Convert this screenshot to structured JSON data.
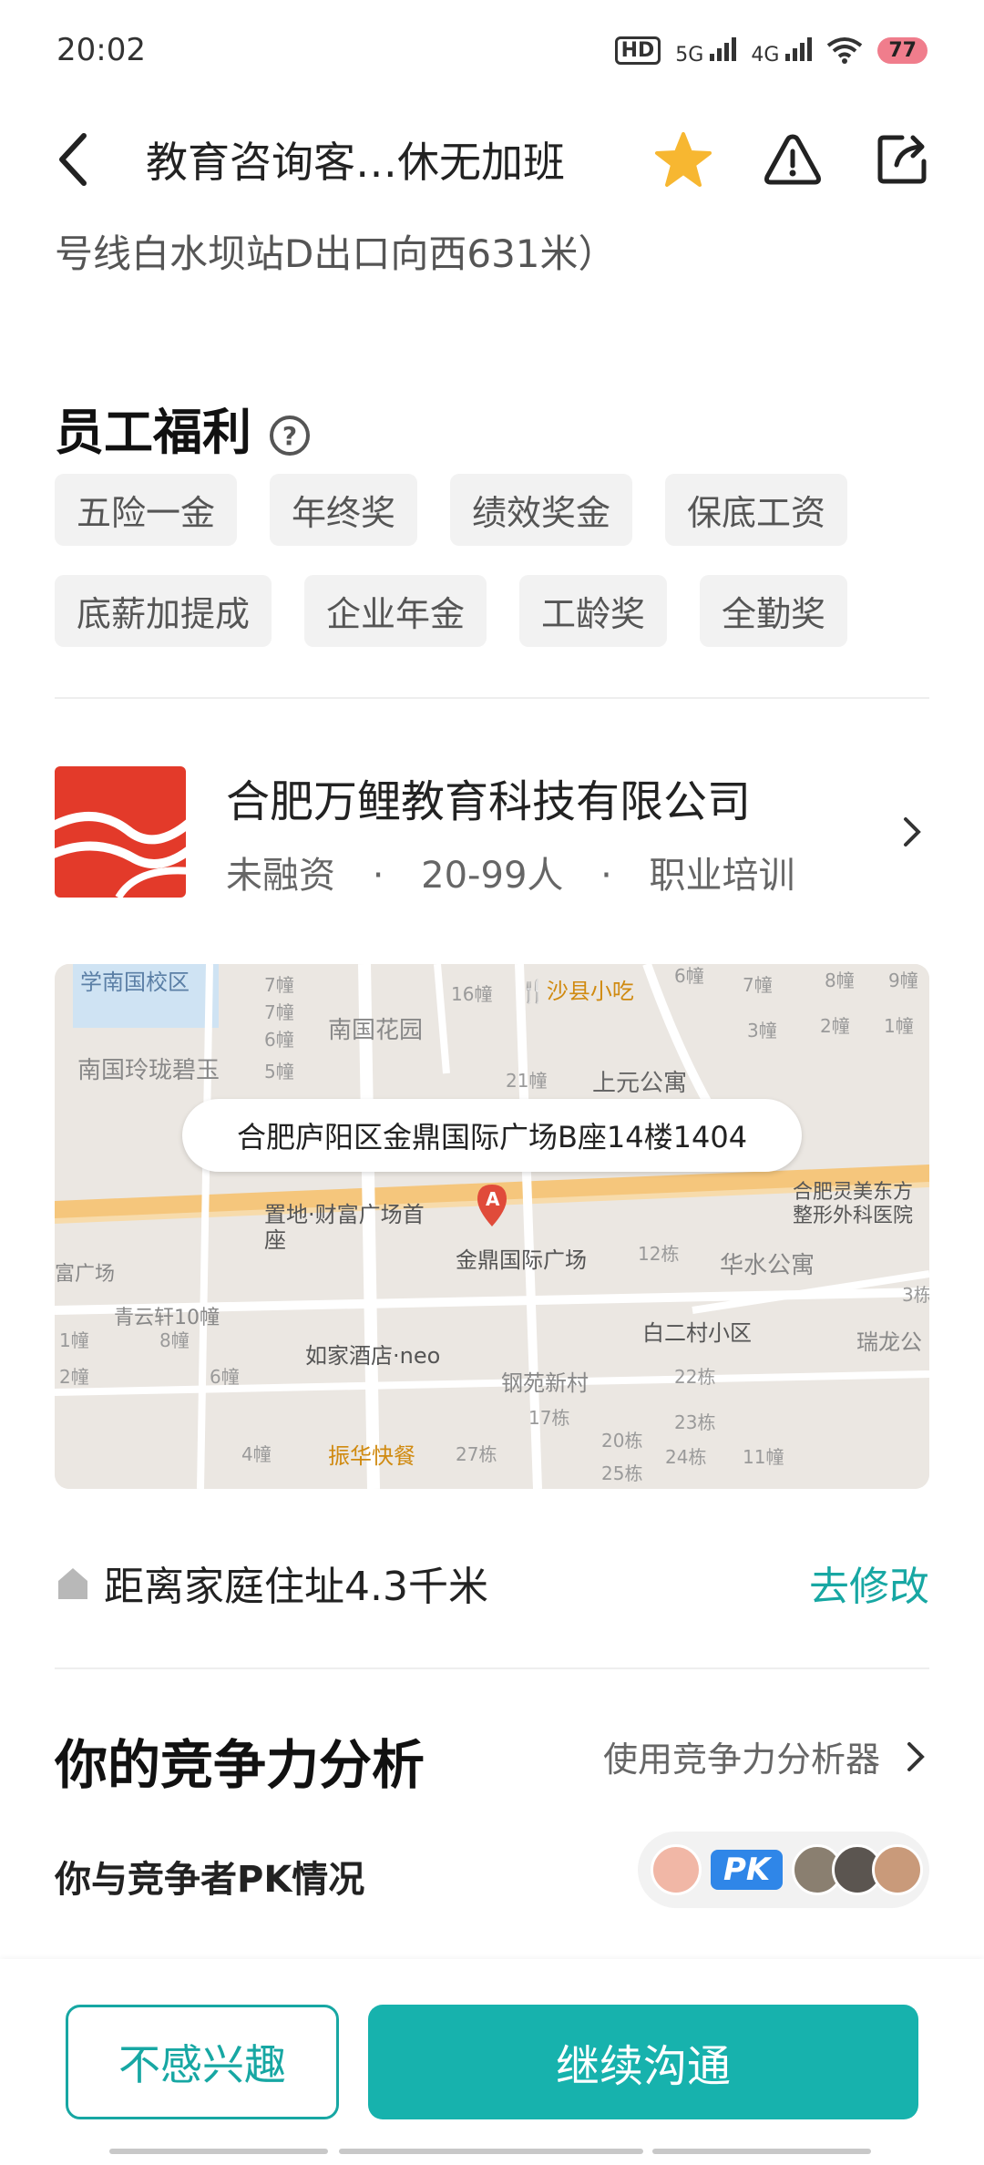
{
  "status_bar": {
    "time": "20:02",
    "hd": "HD",
    "sim1": "5G",
    "sim2": "4G",
    "battery": "77"
  },
  "navbar": {
    "title": "教育咨询客…休无加班"
  },
  "address_tail": "号线白水坝站D出口向西631米）",
  "benefits": {
    "title": "员工福利",
    "help_icon": "?",
    "tags_row1": [
      "五险一金",
      "年终奖",
      "绩效奖金",
      "保底工资"
    ],
    "tags_row2": [
      "底薪加提成",
      "企业年金",
      "工龄奖",
      "全勤奖"
    ]
  },
  "company": {
    "name": "合肥万鲤教育科技有限公司",
    "funding": "未融资",
    "size": "20-99人",
    "industry": "职业培训"
  },
  "map": {
    "address_pill": "合肥庐阳区金鼎国际广场B座14楼1404",
    "marker": "A",
    "labels": {
      "l1": "学南国校区",
      "l2": "南国花园",
      "l3": "沙县小吃",
      "l4": "南国玲珑碧玉",
      "l5": "上元公寓",
      "l6": "置地·财富广场首座",
      "l7": "金鼎国际广场",
      "l8": "华水公寓",
      "l9": "合肥灵美东方整形外科医院",
      "l10": "青云轩10幢",
      "l11": "如家酒店·neo",
      "l12": "白二村小区",
      "l13": "瑞龙公",
      "l14": "钢苑新村",
      "l15": "振华快餐",
      "l16": "富广场"
    }
  },
  "distance": {
    "text": "距离家庭住址4.3千米",
    "action": "去修改"
  },
  "competition": {
    "title": "你的竞争力分析",
    "link": "使用竞争力分析器",
    "pk_label": "你与竞争者PK情况",
    "pk_badge": "PK"
  },
  "bottom": {
    "not_interested": "不感兴趣",
    "continue": "继续沟通"
  }
}
